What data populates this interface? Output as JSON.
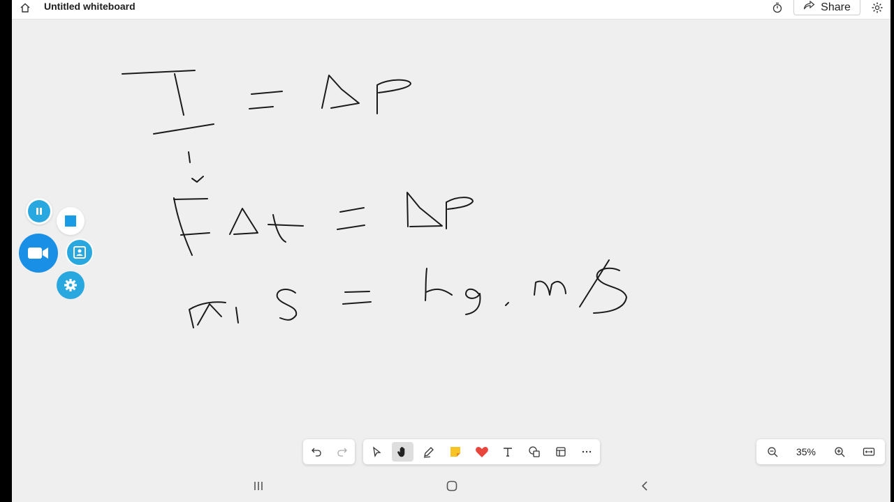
{
  "topbar": {
    "title": "Untitled whiteboard",
    "share_label": "Share",
    "icons": [
      "home-icon",
      "timer-icon",
      "share-icon",
      "settings-icon"
    ]
  },
  "recording": {
    "icons": [
      "pause-icon",
      "stop-icon",
      "camera-icon",
      "portrait-icon",
      "gear-icon"
    ],
    "accent": "#1a9be6",
    "light": "#29a8e0"
  },
  "toolbar": {
    "tools": [
      "undo",
      "redo",
      "select",
      "hand",
      "pen",
      "sticky-note",
      "reactions",
      "text",
      "shapes",
      "templates",
      "more"
    ],
    "active_tool": "hand"
  },
  "zoom": {
    "level": "35%"
  },
  "canvas": {
    "ink_color": "#1a1a1a",
    "handwriting": [
      "I = Δp",
      "FΔt = Δp",
      "N·s = kg·m/s"
    ]
  }
}
